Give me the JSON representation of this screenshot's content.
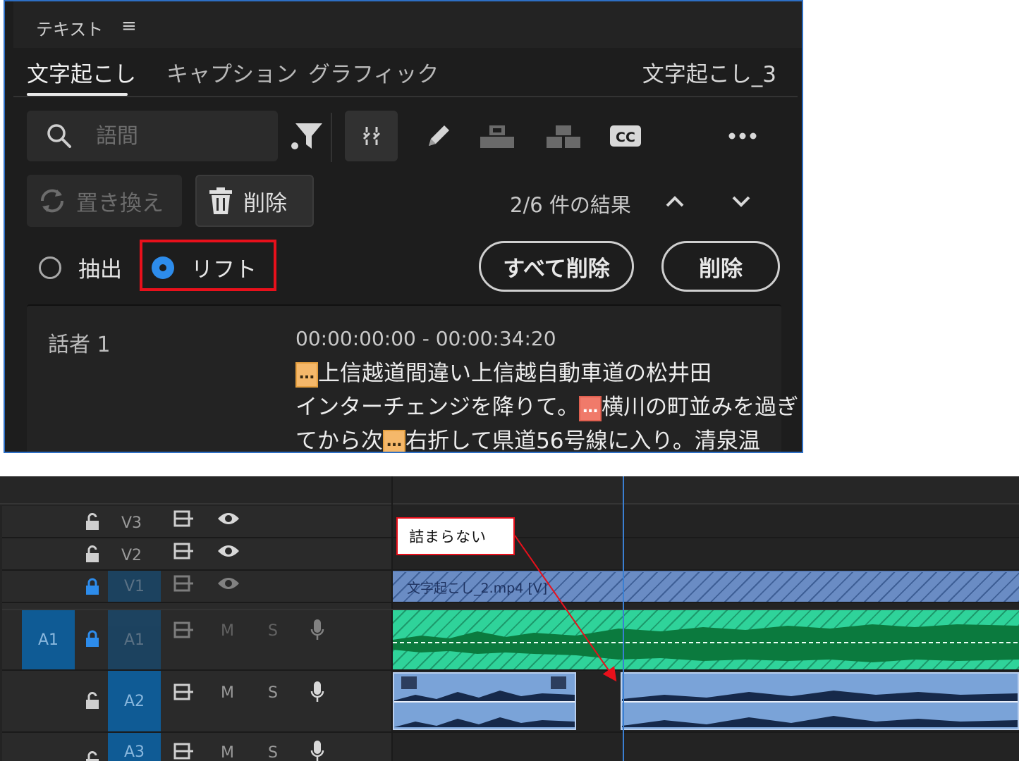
{
  "panel": {
    "title": "テキスト",
    "menu_icon": "hamburger-icon",
    "tabs": [
      {
        "label": "文字起こし",
        "active": true
      },
      {
        "label": "キャプション",
        "active": false
      },
      {
        "label": "グラフィック",
        "active": false
      }
    ],
    "transcript_name": "文字起こし_3",
    "search": {
      "placeholder": "語間",
      "value": ""
    },
    "toolbar_icons": [
      "filter-icon",
      "pause-toggle-icon",
      "pencil-icon",
      "merge-segments-icon",
      "split-segment-icon",
      "cc-icon",
      "more-icon"
    ],
    "replace_label": "置き換え",
    "delete_label": "削除",
    "result_count": "2/6 件の結果",
    "radio_extract": "抽出",
    "radio_lift": "リフト",
    "selected_mode": "lift",
    "delete_all_label": "すべて削除",
    "delete_pill_label": "削除",
    "transcript": {
      "speaker": "話者 1",
      "time": "00:00:00:00 - 00:00:34:20",
      "pause_mark": "…",
      "line1_text": "上信越道間違い上信越自動車道の松井田",
      "line2_a": "インターチェンジを降りて。",
      "line2_b": "横川の町並みを過ぎ",
      "line3_a": "てから次",
      "line3_b": "右折して県道56号線に入り。清泉温"
    },
    "colors": {
      "accent": "#2d8ceb",
      "highlight_box": "#e8101b",
      "pause_orange": "#f5b86a",
      "pause_red": "#f07a6a"
    }
  },
  "timeline": {
    "tracks": [
      {
        "label": "V3",
        "visible_icon": "eye-icon",
        "lock_icon": "unlock-icon"
      },
      {
        "label": "V2",
        "visible_icon": "eye-icon",
        "lock_icon": "unlock-icon"
      },
      {
        "label": "V1",
        "visible_icon": "eye-icon",
        "lock_icon": "lock-icon"
      },
      {
        "label": "A1",
        "source": "A1",
        "mute": "M",
        "solo": "S",
        "lock_icon": "lock-icon"
      },
      {
        "label": "A2",
        "mute": "M",
        "solo": "S",
        "lock_icon": "unlock-icon"
      },
      {
        "label": "A3",
        "mute": "M",
        "solo": "S",
        "lock_icon": "unlock-icon"
      }
    ],
    "v1_clip_label": "文字起こし_2.mp4 [V]",
    "callout": "詰まらない",
    "colors": {
      "video_clip": "#6a8cc4",
      "audio_clip_a1": "#2fd39a",
      "audio_clip_a2": "#7aa3d8",
      "playhead": "#3a7fd2"
    }
  }
}
